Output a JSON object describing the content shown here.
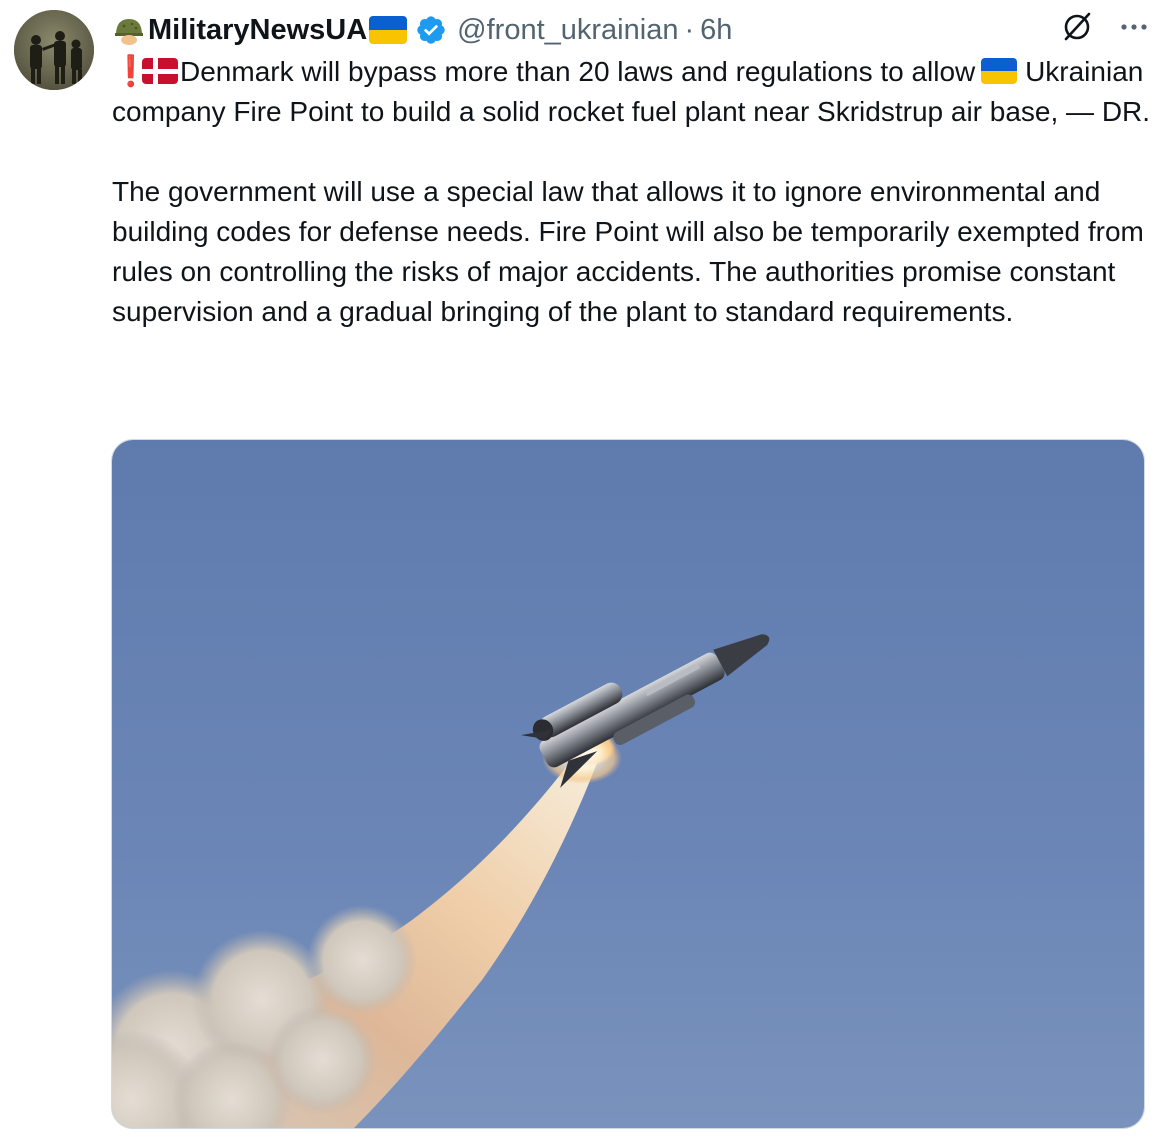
{
  "tweet": {
    "author": {
      "display_name": "MilitaryNewsUA",
      "handle": "@front_ukrainian",
      "verified": true,
      "avatar_icon": "avatar-soldiers-silhouette"
    },
    "separator": "·",
    "time": "6h",
    "paragraph1": "Denmark will bypass more than 20 laws and regulations to allow",
    "paragraph1_cont": "Ukrainian company Fire Point to build a solid rocket fuel plant near Skridstrup air base, — DR.",
    "paragraph2": "The government will use a special law that allows it to ignore environmental and building codes for defense needs. Fire Point will also be temporarily exempted from rules on controlling the risks of major accidents. The authorities promise constant supervision and a gradual bringing of the plant to standard requirements.",
    "exclaim_mark": "❗",
    "icons": {
      "name_emoji": "military-helmet-icon",
      "flag_ua": "ukraine-flag-icon",
      "flag_dk": "denmark-flag-icon",
      "verified": "verified-badge-icon",
      "grok": "grok-icon",
      "more": "more-options-icon"
    },
    "media": {
      "type": "photo",
      "subject": "rocket-launch-photo"
    },
    "colors": {
      "text": "#0f1419",
      "secondary_text": "#536471",
      "verified_blue": "#1d9bf0",
      "sky": "#6b86b6"
    }
  }
}
